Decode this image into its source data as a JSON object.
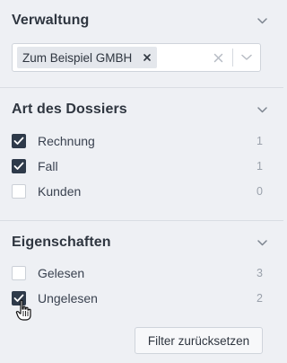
{
  "verwaltung": {
    "title": "Verwaltung",
    "selected": [
      "Zum Beispiel GMBH"
    ]
  },
  "dossier_type": {
    "title": "Art des Dossiers",
    "options": [
      {
        "label": "Rechnung",
        "count": "1",
        "checked": true
      },
      {
        "label": "Fall",
        "count": "1",
        "checked": true
      },
      {
        "label": "Kunden",
        "count": "0",
        "checked": false
      }
    ]
  },
  "properties": {
    "title": "Eigenschaften",
    "options": [
      {
        "label": "Gelesen",
        "count": "3",
        "checked": false
      },
      {
        "label": "Ungelesen",
        "count": "2",
        "checked": true
      }
    ]
  },
  "reset_button_label": "Filter zurücksetzen",
  "colors": {
    "checked": "#2e3a4a",
    "background": "#eef0f4",
    "divider": "#d9dde3",
    "count": "#9aa1ab"
  }
}
